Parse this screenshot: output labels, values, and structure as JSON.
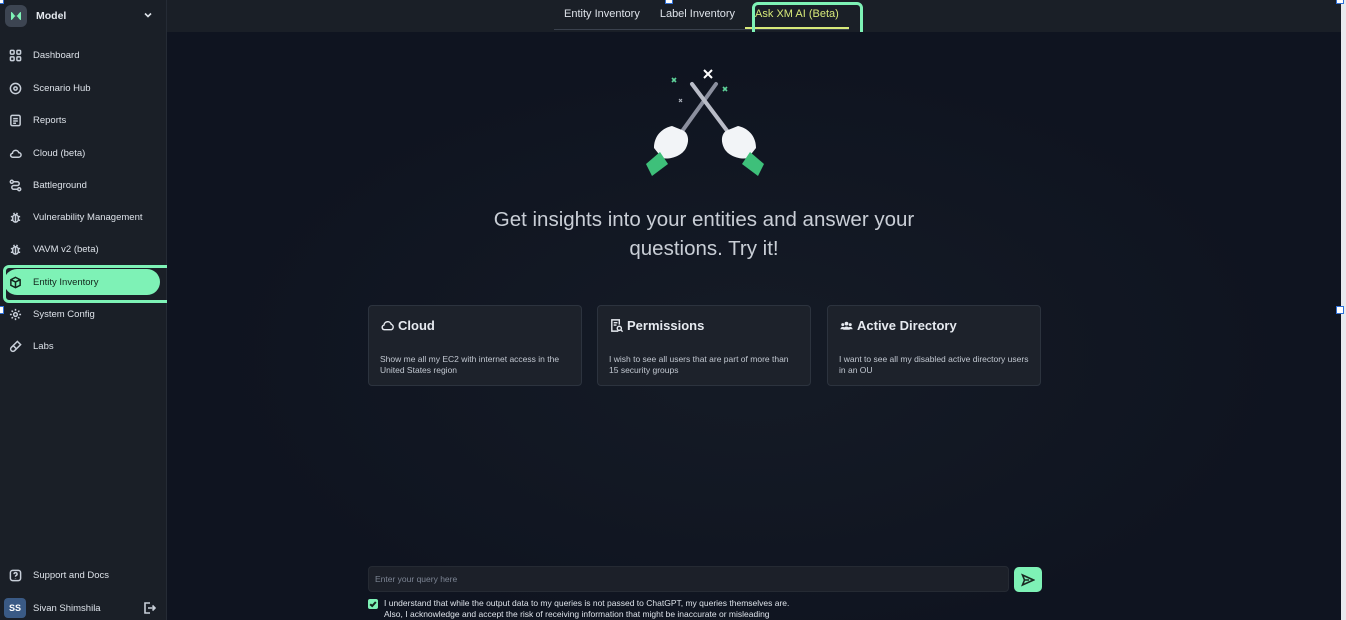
{
  "workspace": {
    "name": "Model"
  },
  "sidebar": {
    "items": [
      {
        "label": "Dashboard",
        "icon": "grid-icon"
      },
      {
        "label": "Scenario Hub",
        "icon": "target-icon"
      },
      {
        "label": "Reports",
        "icon": "document-icon"
      },
      {
        "label": "Cloud (beta)",
        "icon": "cloud-icon"
      },
      {
        "label": "Battleground",
        "icon": "route-icon"
      },
      {
        "label": "Vulnerability Management",
        "icon": "bug-icon"
      },
      {
        "label": "VAVM v2 (beta)",
        "icon": "bug-icon"
      },
      {
        "label": "Entity Inventory",
        "icon": "cube-icon",
        "active": true
      },
      {
        "label": "System Config",
        "icon": "gear-icon"
      },
      {
        "label": "Labs",
        "icon": "flask-icon"
      }
    ],
    "support": {
      "label": "Support and Docs",
      "icon": "help-icon"
    },
    "user": {
      "initials": "SS",
      "name": "Sivan Shimshila"
    }
  },
  "tabs": [
    {
      "label": "Entity Inventory"
    },
    {
      "label": "Label Inventory"
    },
    {
      "label": "Ask XM AI (Beta)",
      "active": true
    }
  ],
  "main": {
    "headline_line1": "Get insights into your entities and answer your",
    "headline_line2": "questions. Try it!",
    "cards": [
      {
        "title": "Cloud",
        "icon": "cloud-icon",
        "body": "Show me all my EC2 with internet access in the United States region"
      },
      {
        "title": "Permissions",
        "icon": "search-document-icon",
        "body": "I wish to see all users that are part of more than 15 security groups"
      },
      {
        "title": "Active Directory",
        "icon": "users-icon",
        "body": "I want to see all my disabled active directory users in an OU"
      }
    ],
    "query": {
      "placeholder": "Enter your query here",
      "value": ""
    },
    "consent": {
      "checked": true,
      "line1": "I understand that while the output data to my queries is not passed to ChatGPT, my queries themselves are.",
      "line2": "Also, I acknowledge and accept the risk of receiving information that might be inaccurate or misleading"
    }
  },
  "colors": {
    "accent": "#7ef2b6",
    "active_tab": "#d8ea7a",
    "sidebar_bg": "#1a1f27",
    "main_bg": "#0f1420"
  }
}
